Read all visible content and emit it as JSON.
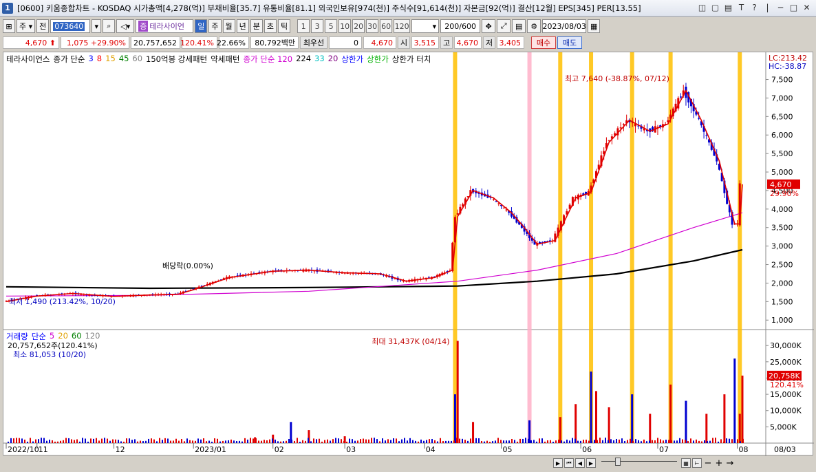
{
  "title": {
    "window_number": "1",
    "text": "[0600] 키움종합차트 - KOSDAQ 시가총액[4,278(억)] 부채비율[35.7] 유통비율[81.1] 외국인보유[974(천)] 주식수[91,614(천)] 자본금[92(억)] 결산[12월] EPS[345] PER[13.55]"
  },
  "window_controls": [
    "◫",
    "▢",
    "▤",
    "T",
    "?",
    "|",
    "─",
    "□",
    "✕"
  ],
  "toolbar": {
    "period_select": "주",
    "whole_btn": "전",
    "code": "073640",
    "stock_name": "테라사이언",
    "periods": [
      "일",
      "주",
      "월",
      "년",
      "분",
      "초",
      "틱"
    ],
    "active_period": "일",
    "minutes": [
      "1",
      "3",
      "5",
      "10",
      "20",
      "30",
      "60",
      "120"
    ],
    "count": "200",
    "count_total": "/600",
    "date": "2023/08/03"
  },
  "infobar": {
    "price": "4,670",
    "change": "1,075",
    "change_pct": "+29.90%",
    "volume": "20,757,652",
    "volume_ratio": "120.41%",
    "turnover": "22.66%",
    "amount": "80,792백만",
    "best_quote_label": "최우선",
    "best_quote_value": "0",
    "best_price": "4,670",
    "open_label": "시",
    "open": "3,515",
    "high_label": "고",
    "high": "4,670",
    "low_label": "저",
    "low": "3,405",
    "buy": "매수",
    "sell": "매도"
  },
  "price_legend": [
    {
      "text": "테라사이언스",
      "color": "#000000"
    },
    {
      "text": "종가 단순",
      "color": "#000000"
    },
    {
      "text": "3",
      "color": "#0000ff"
    },
    {
      "text": "8",
      "color": "#ff0000"
    },
    {
      "text": "15",
      "color": "#e0a000"
    },
    {
      "text": "45",
      "color": "#008000"
    },
    {
      "text": "60",
      "color": "#808080"
    },
    {
      "text": "150억봉 강세패턴",
      "color": "#000000"
    },
    {
      "text": "약세패턴",
      "color": "#000000"
    },
    {
      "text": "종가 단순 120",
      "color": "#d000d0"
    },
    {
      "text": "224",
      "color": "#000000"
    },
    {
      "text": "33",
      "color": "#00c0c0"
    },
    {
      "text": "20",
      "color": "#800080"
    },
    {
      "text": "상한가",
      "color": "#0000ff"
    },
    {
      "text": "상한가",
      "color": "#00b000"
    },
    {
      "text": "상한가 터치",
      "color": "#000000"
    }
  ],
  "volume_legend": [
    {
      "text": "거래량",
      "color": "#0000ff"
    },
    {
      "text": "단순",
      "color": "#0000ff"
    },
    {
      "text": "5",
      "color": "#d000d0"
    },
    {
      "text": "20",
      "color": "#e0a000"
    },
    {
      "text": "60",
      "color": "#008000"
    },
    {
      "text": "120",
      "color": "#808080"
    }
  ],
  "volume_info": "20,757,652주(120.41%)",
  "volume_min": "최소 81,053 (10/20)",
  "volume_max": "최대 31,437K (04/14)",
  "price_high": "최고 7,640 (-38.87%, 07/12)",
  "price_low": "최저 1,490 (213.42%, 10/20)",
  "dividend": "배당락(0.00%)",
  "lc": "LC:213.42",
  "hc": "HC:-38.87",
  "current_price_tag": "4,670",
  "current_pct_tag": "29.90%",
  "current_vol_tag": "20,758K",
  "current_vol_pct": "120.41%",
  "price_axis": [
    "7,500",
    "7,000",
    "6,500",
    "6,000",
    "5,500",
    "5,000",
    "4,500",
    "4,000",
    "3,500",
    "3,000",
    "2,500",
    "2,000",
    "1,500",
    "1,000"
  ],
  "volume_axis": [
    "30,000K",
    "25,000K",
    "20,000K",
    "15,000K",
    "10,000K",
    "5,000K"
  ],
  "time_axis": [
    "2022/10",
    "11",
    "12",
    "2023/01",
    "02",
    "03",
    "04",
    "05",
    "06",
    "07",
    "08",
    "08/03"
  ],
  "colors": {
    "up": "#e00000",
    "down": "#0000d0",
    "highlight_orange": "#ffc000",
    "highlight_pink": "#ffb0c8"
  },
  "chart_data": {
    "type": "candlestick",
    "x_range": [
      "2022-10-20",
      "2023-08-03"
    ],
    "price_ylim": [
      800,
      7900
    ],
    "volume_ylim": [
      0,
      33000
    ],
    "volume_unit": "K",
    "highlight_dates": [
      "2023-04-13",
      "2023-05-12",
      "2023-05-24",
      "2023-06-05",
      "2023-06-21",
      "2023-07-06",
      "2023-08-02"
    ],
    "price_path": [
      [
        "2022-10-20",
        1500
      ],
      [
        "2022-11-01",
        1650
      ],
      [
        "2022-11-15",
        1720
      ],
      [
        "2022-12-01",
        1640
      ],
      [
        "2022-12-15",
        1680
      ],
      [
        "2022-12-26",
        1700
      ],
      [
        "2023-01-01",
        1820
      ],
      [
        "2023-01-15",
        2150
      ],
      [
        "2023-02-01",
        2320
      ],
      [
        "2023-02-15",
        2350
      ],
      [
        "2023-03-01",
        2280
      ],
      [
        "2023-03-15",
        2250
      ],
      [
        "2023-03-25",
        2050
      ],
      [
        "2023-04-05",
        2150
      ],
      [
        "2023-04-12",
        2350
      ],
      [
        "2023-04-14",
        3800
      ],
      [
        "2023-04-20",
        4500
      ],
      [
        "2023-04-28",
        4300
      ],
      [
        "2023-05-05",
        3900
      ],
      [
        "2023-05-10",
        3500
      ],
      [
        "2023-05-15",
        3050
      ],
      [
        "2023-05-22",
        3150
      ],
      [
        "2023-05-30",
        4300
      ],
      [
        "2023-06-05",
        4450
      ],
      [
        "2023-06-12",
        5800
      ],
      [
        "2023-06-20",
        6400
      ],
      [
        "2023-06-28",
        6100
      ],
      [
        "2023-07-05",
        6300
      ],
      [
        "2023-07-12",
        7200
      ],
      [
        "2023-07-18",
        6400
      ],
      [
        "2023-07-25",
        5300
      ],
      [
        "2023-07-31",
        3600
      ],
      [
        "2023-08-02",
        3600
      ],
      [
        "2023-08-03",
        4670
      ]
    ],
    "ma224_path": [
      [
        "2022-10-20",
        1900
      ],
      [
        "2022-12-15",
        1860
      ],
      [
        "2023-02-15",
        1880
      ],
      [
        "2023-04-14",
        1920
      ],
      [
        "2023-05-15",
        2050
      ],
      [
        "2023-06-15",
        2250
      ],
      [
        "2023-07-15",
        2600
      ],
      [
        "2023-08-03",
        2900
      ]
    ],
    "ma120_path": [
      [
        "2022-10-20",
        1650
      ],
      [
        "2022-12-15",
        1670
      ],
      [
        "2023-02-15",
        1780
      ],
      [
        "2023-04-14",
        2050
      ],
      [
        "2023-05-15",
        2350
      ],
      [
        "2023-06-15",
        2800
      ],
      [
        "2023-07-15",
        3500
      ],
      [
        "2023-08-03",
        3900
      ]
    ],
    "volume_bars": [
      [
        "2023-01-25",
        1800
      ],
      [
        "2023-02-01",
        2600
      ],
      [
        "2023-02-08",
        6500
      ],
      [
        "2023-02-15",
        4000
      ],
      [
        "2023-03-01",
        2100
      ],
      [
        "2023-04-13",
        15000
      ],
      [
        "2023-04-14",
        31437
      ],
      [
        "2023-04-20",
        6500
      ],
      [
        "2023-05-12",
        7000
      ],
      [
        "2023-05-24",
        8000
      ],
      [
        "2023-05-30",
        12000
      ],
      [
        "2023-06-05",
        22000
      ],
      [
        "2023-06-07",
        16000
      ],
      [
        "2023-06-12",
        11000
      ],
      [
        "2023-06-21",
        15000
      ],
      [
        "2023-06-28",
        9000
      ],
      [
        "2023-07-06",
        18000
      ],
      [
        "2023-07-12",
        13000
      ],
      [
        "2023-07-20",
        9000
      ],
      [
        "2023-07-27",
        15000
      ],
      [
        "2023-07-31",
        26000
      ],
      [
        "2023-08-02",
        9000
      ],
      [
        "2023-08-03",
        20758
      ]
    ]
  }
}
